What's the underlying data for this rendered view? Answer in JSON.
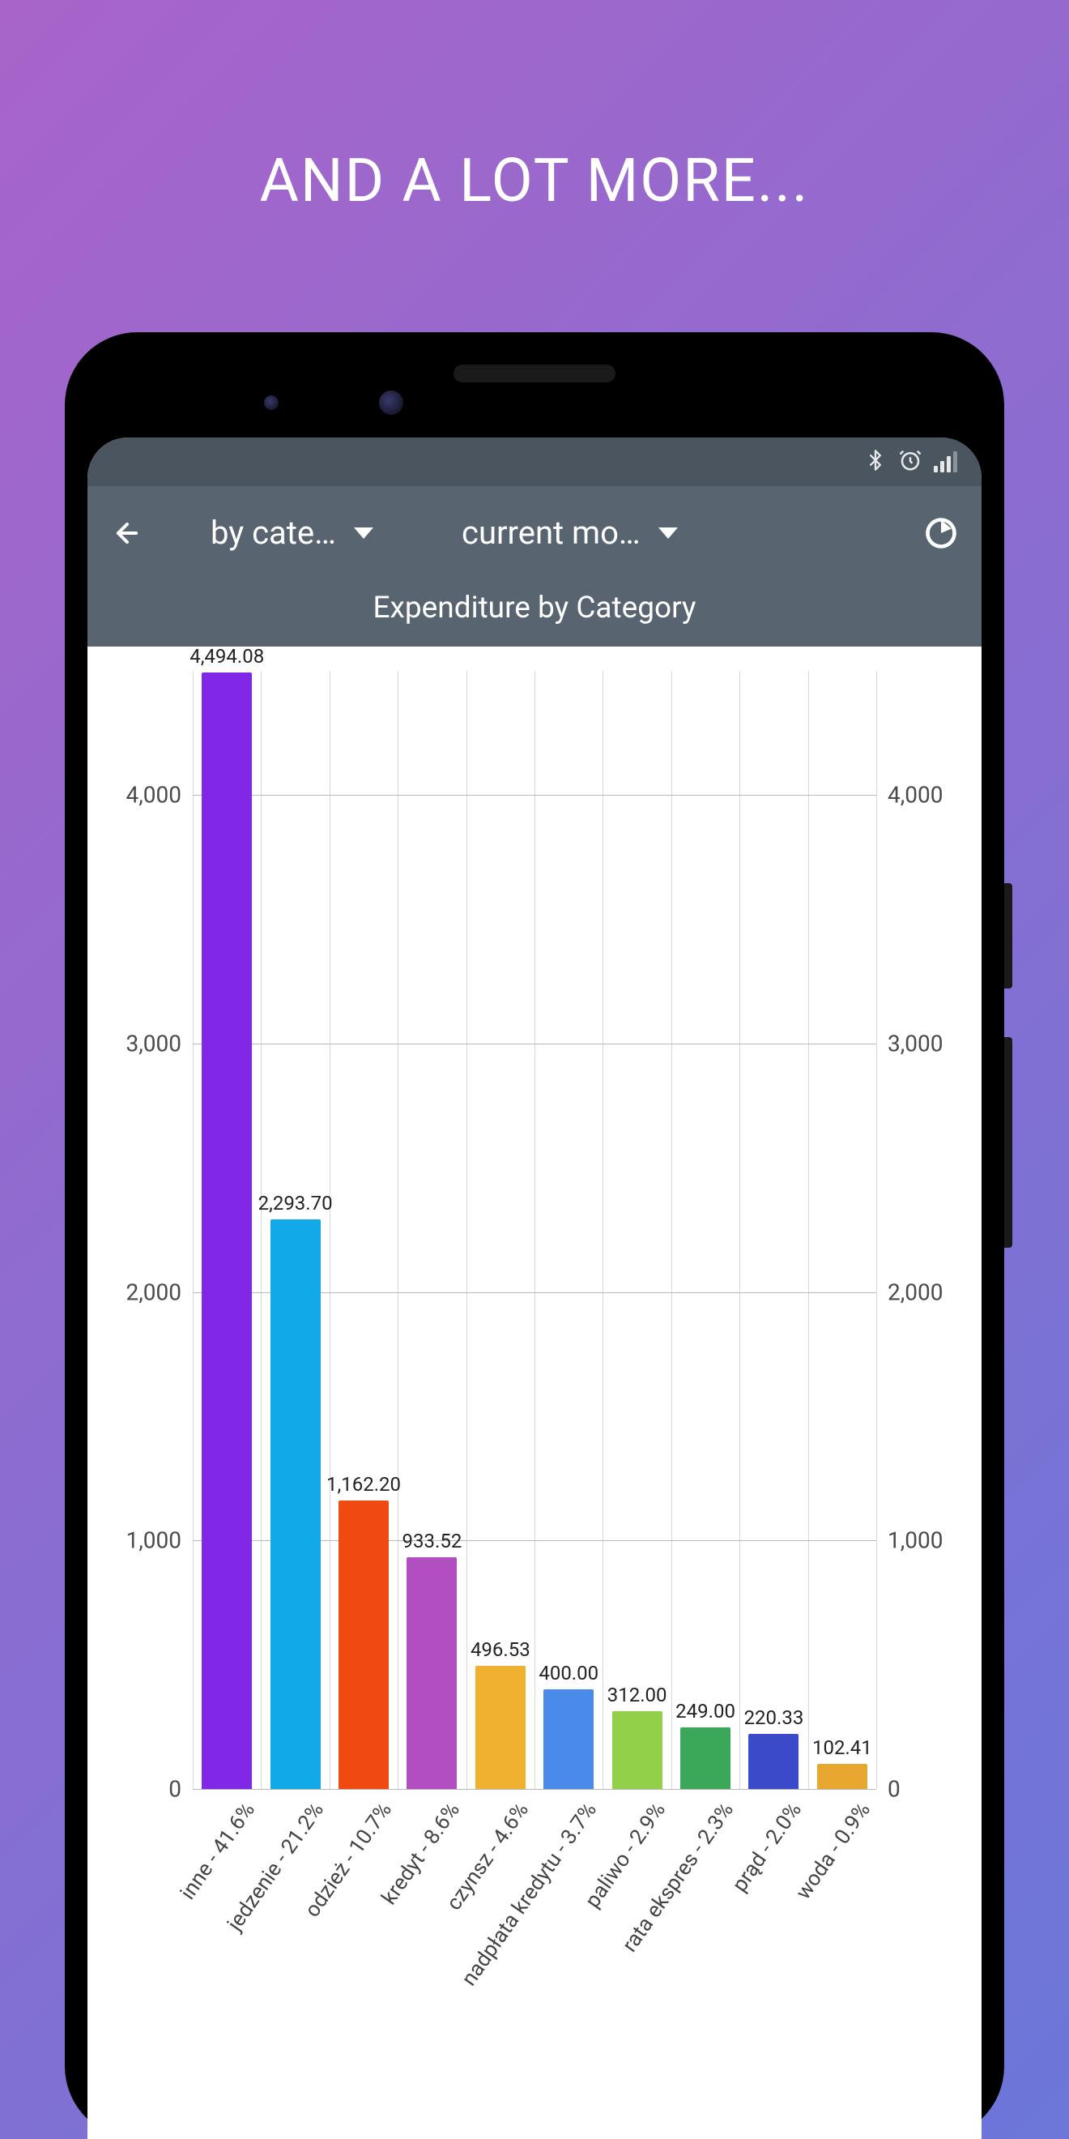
{
  "hero": {
    "text": "AND A LOT MORE..."
  },
  "status_bar": {
    "bluetooth_icon": "bluetooth",
    "alarm_icon": "alarm",
    "signal_icon": "signal"
  },
  "app_bar": {
    "dropdown1_label": "by cate…",
    "dropdown2_label": "current mo…"
  },
  "chart_title": "Expenditure by Category",
  "y_ticks": [
    "0",
    "1,000",
    "2,000",
    "3,000",
    "4,000"
  ],
  "chart_data": {
    "type": "bar",
    "title": "Expenditure by Category",
    "ylabel": "",
    "xlabel": "",
    "ylim": [
      0,
      4500
    ],
    "categories": [
      "inne - 41.6%",
      "jedzenie - 21.2%",
      "odzież - 10.7%",
      "kredyt - 8.6%",
      "czynsz - 4.6%",
      "nadpłata kredytu - 3.7%",
      "paliwo - 2.9%",
      "rata ekspres - 2.3%",
      "prąd - 2.0%",
      "woda - 0.9%"
    ],
    "values": [
      4494.08,
      2293.7,
      1162.2,
      933.52,
      496.53,
      400.0,
      312.0,
      249.0,
      220.33,
      102.41
    ],
    "value_labels": [
      "4,494.08",
      "2,293.70",
      "1,162.20",
      "933.52",
      "496.53",
      "400.00",
      "312.00",
      "249.00",
      "220.33",
      "102.41"
    ],
    "colors": [
      "#8128e8",
      "#12a9e8",
      "#f04a12",
      "#b24fc0",
      "#f0b030",
      "#4a8ae8",
      "#92d04a",
      "#3aa858",
      "#3a4ac8",
      "#e8a830"
    ]
  }
}
